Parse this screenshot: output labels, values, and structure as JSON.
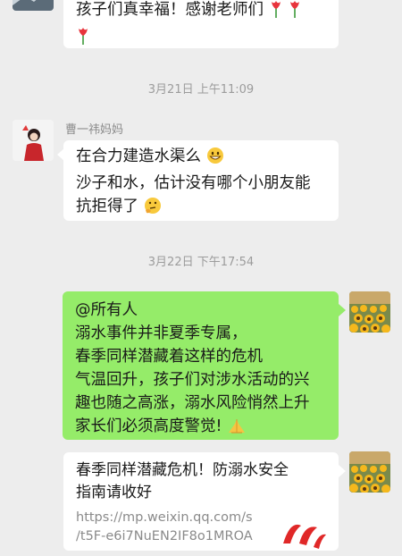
{
  "messages": {
    "m1": {
      "line1": "孩子们真幸福！感谢老师们",
      "emoji_after": "tulip-emoji"
    },
    "ts1": "3月21日 上午11:09",
    "m2": {
      "sender": "曹一祎妈妈",
      "line1": "在合力建造水渠么",
      "line2": "沙子和水，估计没有哪个小朋友能",
      "line3": "抗拒得了",
      "emoji1": "grinning-face-emoji",
      "emoji2": "thinking-face-emoji"
    },
    "ts2": "3月22日 下午17:54",
    "m3": {
      "line1": "@所有人",
      "line2": "溺水事件并非夏季专属，",
      "line3": "春季同样潜藏着这样的危机",
      "line4": "气温回升，孩子们对涉水活动的兴",
      "line5": "趣也随之高涨，溺水风险悄然上升",
      "line6": "家长们必须高度警觉!",
      "emoji": "folded-hands-emoji"
    },
    "m4": {
      "title_line1": "春季同样潜藏危机！防溺水安全",
      "title_line2": "指南请收好",
      "url_line1": "https://mp.weixin.qq.com/s",
      "url_line2": "/t5F-e6i7NuEN2IF8o1MROA"
    }
  },
  "colors": {
    "background": "#ededed",
    "my_bubble": "#95ec69",
    "other_bubble": "#ffffff",
    "timestamp": "#9c9c9c"
  }
}
